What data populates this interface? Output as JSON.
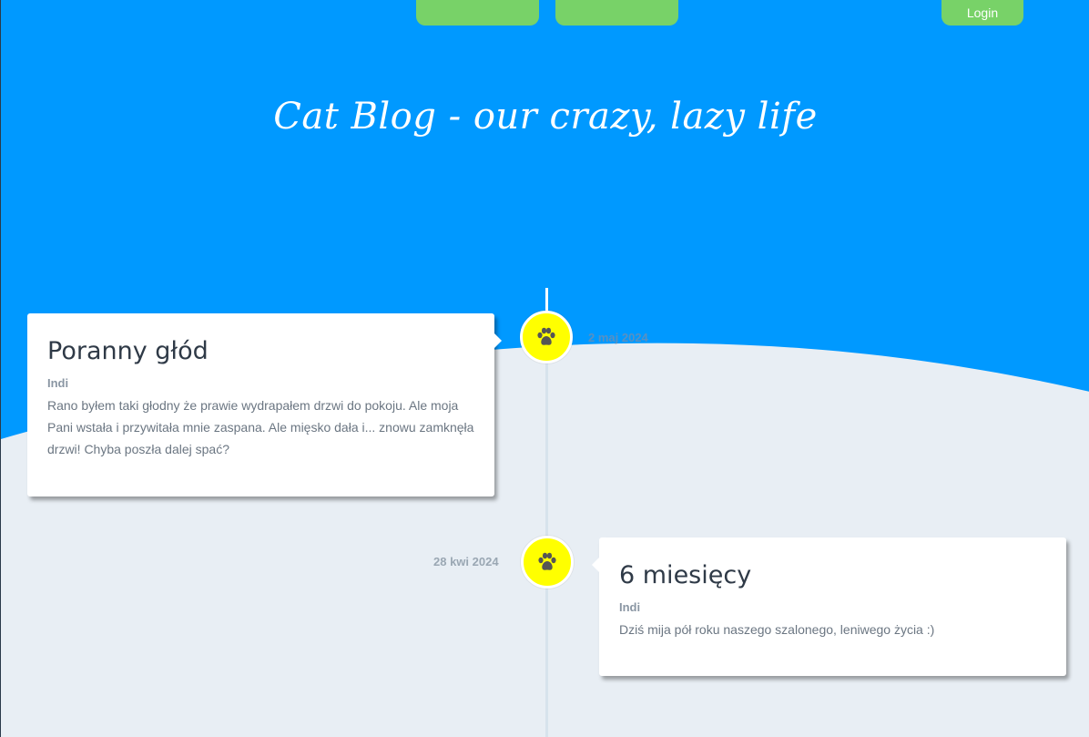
{
  "colors": {
    "hero_blue": "#0099ff",
    "page_bg": "#e8eef4",
    "nav_green": "#78d268",
    "node_yellow": "#ffff00"
  },
  "nav": {
    "button1_label": "",
    "button2_label": "",
    "login_label": "Login"
  },
  "hero": {
    "title": "Cat Blog - our crazy, lazy life"
  },
  "posts": [
    {
      "title": "Poranny głód",
      "author": "Indi",
      "body": "Rano byłem taki głodny że prawie wydrapałem drzwi do pokoju. Ale moja Pani wstała i przywitała mnie zaspana. Ale mięsko dała i... znowu zamknęła drzwi! Chyba poszła dalej spać?",
      "date": "2 maj 2024",
      "icon": "paw-icon"
    },
    {
      "title": "6 miesięcy",
      "author": "Indi",
      "body": "Dziś mija pół roku naszego szalonego, leniwego życia :)",
      "date": "28 kwi 2024",
      "icon": "paw-icon"
    }
  ]
}
